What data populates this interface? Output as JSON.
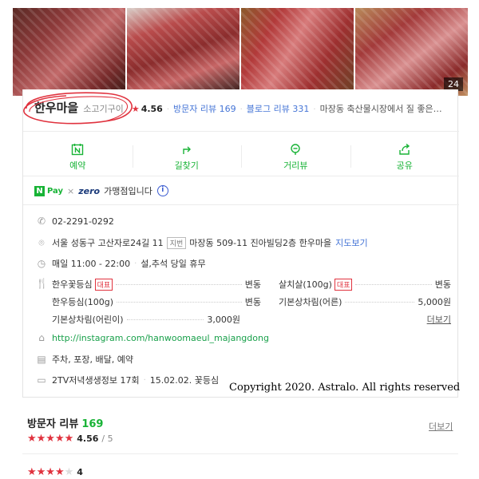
{
  "photos": {
    "count": "24"
  },
  "place": {
    "name": "한우마을",
    "category": "소고기구이",
    "star_icon": "★",
    "score": "4.56",
    "visitor_review_label": "방문자 리뷰 169",
    "blog_review_label": "블로그 리뷰 331",
    "description": "마장동 축산물시장에서 질 좋은…"
  },
  "actions": [
    {
      "label": "예약",
      "icon": "calendar-n-icon"
    },
    {
      "label": "길찾기",
      "icon": "directions-icon"
    },
    {
      "label": "거리뷰",
      "icon": "street-view-icon"
    },
    {
      "label": "공유",
      "icon": "share-icon"
    }
  ],
  "pay": {
    "npay_badge": "N",
    "npay_word": "Pay",
    "times": "×",
    "zero_word": "zero",
    "text": "가맹점입니다",
    "info_icon": "i"
  },
  "info": {
    "phone": "02-2291-0292",
    "road_address": "서울 성동구 고산자로24길 11",
    "lot_badge": "지번",
    "lot_address": "마장동 509-11 진아빌딩2층 한우마을",
    "map_link": "지도보기",
    "hours": "매일 11:00 - 22:00",
    "hours_note": "설,추석 당일 휴무",
    "website": "http://instagram.com/hanwoomaeul_majangdong",
    "amenities": "주차, 포장, 배달, 예약",
    "tv": "2TV저녁생생정보 17회",
    "tv_date": "15.02.02. 꽃등심"
  },
  "menu": {
    "items": [
      {
        "name": "한우꽃등심",
        "badge": "대표",
        "price": "변동"
      },
      {
        "name": "살치살(100g)",
        "badge": "대표",
        "price": "변동"
      },
      {
        "name": "한우등심(100g)",
        "badge": "",
        "price": "변동"
      },
      {
        "name": "기본상차림(어른)",
        "badge": "",
        "price": "5,000원"
      },
      {
        "name": "기본상차림(어린이)",
        "badge": "",
        "price": "3,000원"
      }
    ],
    "more": "더보기"
  },
  "overlay": {
    "copyright": "Copyright 2020. Astralo. All rights reserved"
  },
  "reviews": {
    "title": "방문자 리뷰",
    "count": "169",
    "more": "더보기",
    "avg": "4.56",
    "max": "/ 5",
    "stars_avg": "★★★★★",
    "first_rating": "4",
    "first_stars_on": "★★★★",
    "first_stars_off": "★"
  },
  "colors": {
    "accent_green": "#18b336",
    "star_red": "#e0323e",
    "link_blue": "#4474d6",
    "circle_red": "#e0323e"
  }
}
